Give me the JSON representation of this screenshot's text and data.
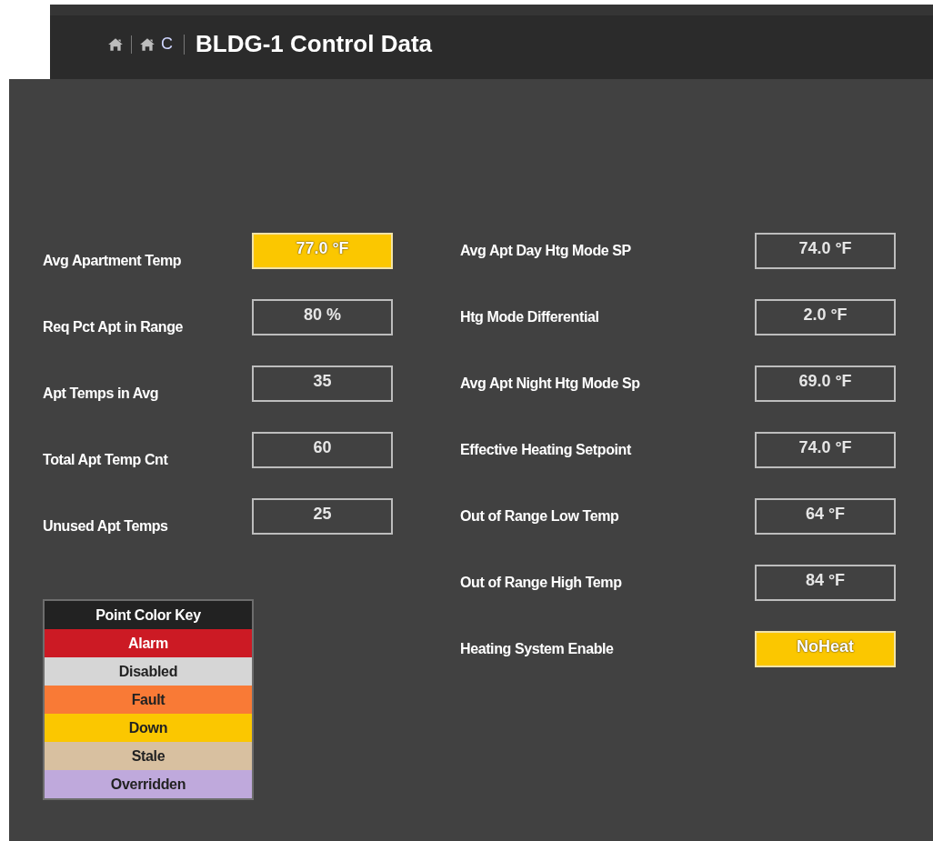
{
  "header": {
    "breadcrumb": "C",
    "title": "BLDG-1 Control Data"
  },
  "left_points": [
    {
      "label": "Avg Apartment Temp",
      "value": "77.0 °F",
      "down": true
    },
    {
      "label": "Req Pct Apt in Range",
      "value": "80 %",
      "down": false
    },
    {
      "label": "Apt Temps in Avg",
      "value": "35",
      "down": false
    },
    {
      "label": "Total Apt Temp Cnt",
      "value": "60",
      "down": false
    },
    {
      "label": "Unused Apt Temps",
      "value": "25",
      "down": false
    }
  ],
  "right_points": [
    {
      "label": "Avg Apt Day Htg Mode SP",
      "value": "74.0 °F",
      "down": false
    },
    {
      "label": "Htg Mode Differential",
      "value": "2.0 °F",
      "down": false
    },
    {
      "label": "Avg Apt Night Htg Mode Sp",
      "value": "69.0 °F",
      "down": false
    },
    {
      "label": "Effective Heating Setpoint",
      "value": "74.0 °F",
      "down": false
    },
    {
      "label": "Out of Range Low Temp",
      "value": "64 °F",
      "down": false
    },
    {
      "label": "Out of Range High Temp",
      "value": "84 °F",
      "down": false
    },
    {
      "label": "Heating System Enable",
      "value": "NoHeat",
      "down": true
    }
  ],
  "color_key": {
    "title": "Point Color Key",
    "items": [
      {
        "label": "Alarm",
        "color": "#cc1a24"
      },
      {
        "label": "Disabled",
        "color": "#d6d6d6"
      },
      {
        "label": "Fault",
        "color": "#f97a36"
      },
      {
        "label": "Down",
        "color": "#fbc700"
      },
      {
        "label": "Stale",
        "color": "#d8c0a0"
      },
      {
        "label": "Overridden",
        "color": "#bfa9dc"
      }
    ]
  }
}
